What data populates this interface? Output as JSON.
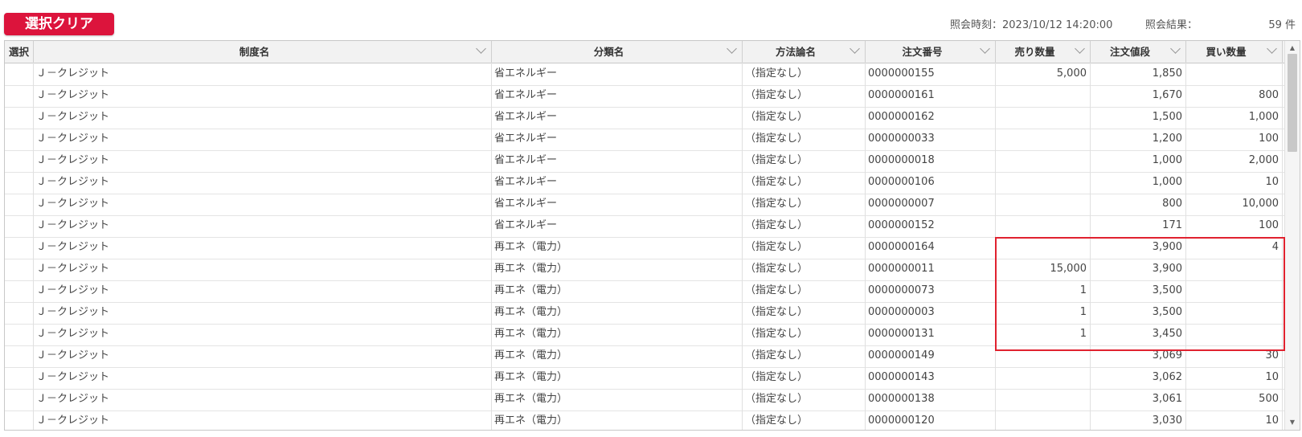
{
  "toolbar": {
    "clear_label": "選択クリア"
  },
  "query": {
    "time_label": "照会時刻：2023/10/12 14:20:00",
    "result_label": "照会結果：",
    "result_count": "59 件"
  },
  "columns": [
    "選択",
    "制度名",
    "分類名",
    "方法論名",
    "注文番号",
    "売り数量",
    "注文値段",
    "買い数量"
  ],
  "rows": [
    [
      "",
      "Ｊ－クレジット",
      "省エネルギー",
      "（指定なし）",
      "0000000155",
      "5,000",
      "1,850",
      ""
    ],
    [
      "",
      "Ｊ－クレジット",
      "省エネルギー",
      "（指定なし）",
      "0000000161",
      "",
      "1,670",
      "800"
    ],
    [
      "",
      "Ｊ－クレジット",
      "省エネルギー",
      "（指定なし）",
      "0000000162",
      "",
      "1,500",
      "1,000"
    ],
    [
      "",
      "Ｊ－クレジット",
      "省エネルギー",
      "（指定なし）",
      "0000000033",
      "",
      "1,200",
      "100"
    ],
    [
      "",
      "Ｊ－クレジット",
      "省エネルギー",
      "（指定なし）",
      "0000000018",
      "",
      "1,000",
      "2,000"
    ],
    [
      "",
      "Ｊ－クレジット",
      "省エネルギー",
      "（指定なし）",
      "0000000106",
      "",
      "1,000",
      "10"
    ],
    [
      "",
      "Ｊ－クレジット",
      "省エネルギー",
      "（指定なし）",
      "0000000007",
      "",
      "800",
      "10,000"
    ],
    [
      "",
      "Ｊ－クレジット",
      "省エネルギー",
      "（指定なし）",
      "0000000152",
      "",
      "171",
      "100"
    ],
    [
      "",
      "Ｊ－クレジット",
      "再エネ（電力）",
      "（指定なし）",
      "0000000164",
      "",
      "3,900",
      "4"
    ],
    [
      "",
      "Ｊ－クレジット",
      "再エネ（電力）",
      "（指定なし）",
      "0000000011",
      "15,000",
      "3,900",
      ""
    ],
    [
      "",
      "Ｊ－クレジット",
      "再エネ（電力）",
      "（指定なし）",
      "0000000073",
      "1",
      "3,500",
      ""
    ],
    [
      "",
      "Ｊ－クレジット",
      "再エネ（電力）",
      "（指定なし）",
      "0000000003",
      "1",
      "3,500",
      ""
    ],
    [
      "",
      "Ｊ－クレジット",
      "再エネ（電力）",
      "（指定なし）",
      "0000000131",
      "1",
      "3,450",
      ""
    ],
    [
      "",
      "Ｊ－クレジット",
      "再エネ（電力）",
      "（指定なし）",
      "0000000149",
      "",
      "3,069",
      "30"
    ],
    [
      "",
      "Ｊ－クレジット",
      "再エネ（電力）",
      "（指定なし）",
      "0000000143",
      "",
      "3,062",
      "10"
    ],
    [
      "",
      "Ｊ－クレジット",
      "再エネ（電力）",
      "（指定なし）",
      "0000000138",
      "",
      "3,061",
      "500"
    ],
    [
      "",
      "Ｊ－クレジット",
      "再エネ（電力）",
      "（指定なし）",
      "0000000120",
      "",
      "3,030",
      "10"
    ]
  ],
  "scrollbar": {
    "up_icon": "▲",
    "down_icon": "▼"
  },
  "colors": {
    "accent": "#dc143c",
    "highlight": "#e0222f",
    "header_bg": "#f2f2f2"
  }
}
